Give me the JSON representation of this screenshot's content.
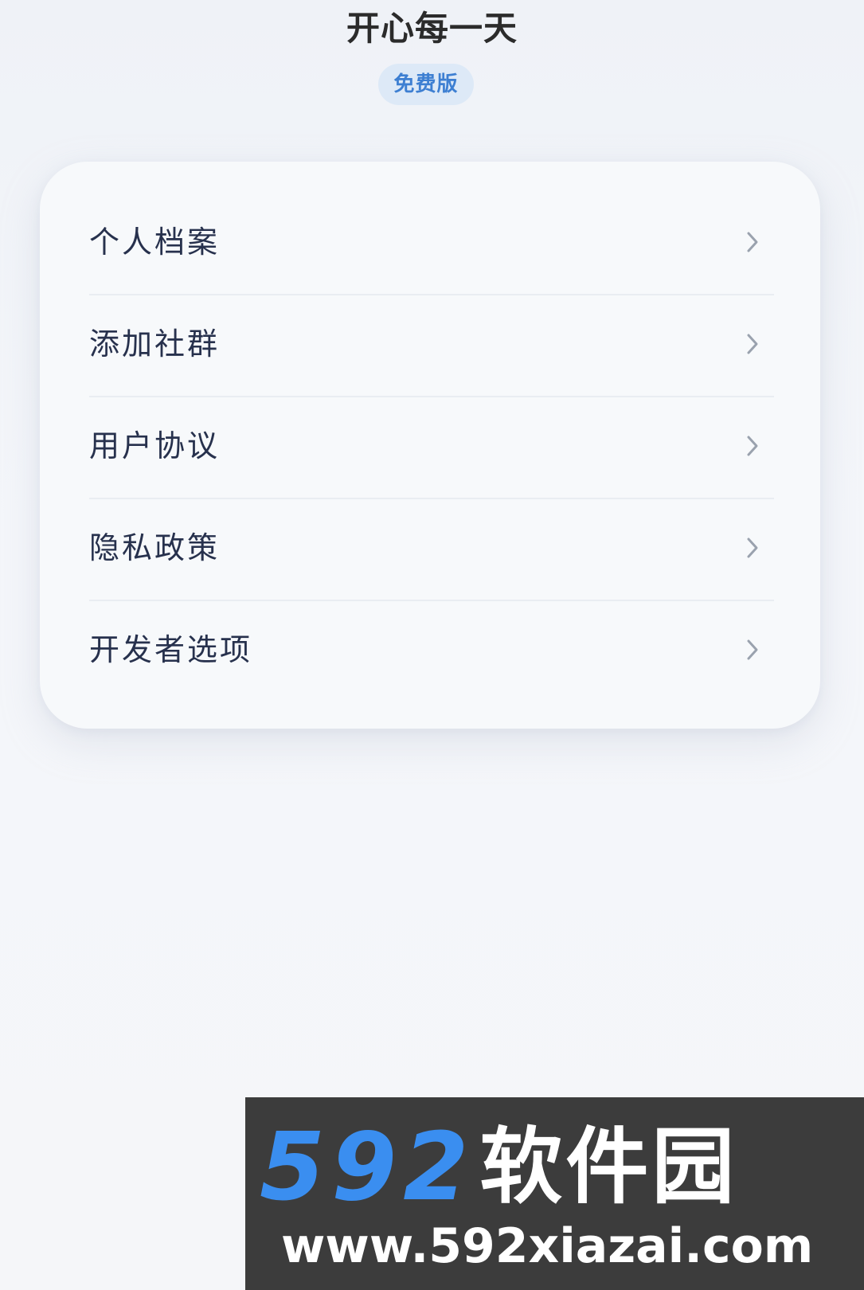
{
  "header": {
    "title": "开心每一天",
    "badge": "免费版"
  },
  "menu": {
    "items": [
      {
        "label": "个人档案",
        "icon": "chevron-right-icon"
      },
      {
        "label": "添加社群",
        "icon": "chevron-right-icon"
      },
      {
        "label": "用户协议",
        "icon": "chevron-right-icon"
      },
      {
        "label": "隐私政策",
        "icon": "chevron-right-icon"
      },
      {
        "label": "开发者选项",
        "icon": "chevron-right-icon"
      }
    ]
  },
  "watermark": {
    "number": "592",
    "name": "软件园",
    "url": "www.592xiazai.com"
  },
  "colors": {
    "accent": "#3d7fd2",
    "badge_bg": "#dde9f7",
    "text_primary": "#27314d",
    "watermark_blue": "#3a8ef0",
    "watermark_bg": "#3c3c3c"
  }
}
